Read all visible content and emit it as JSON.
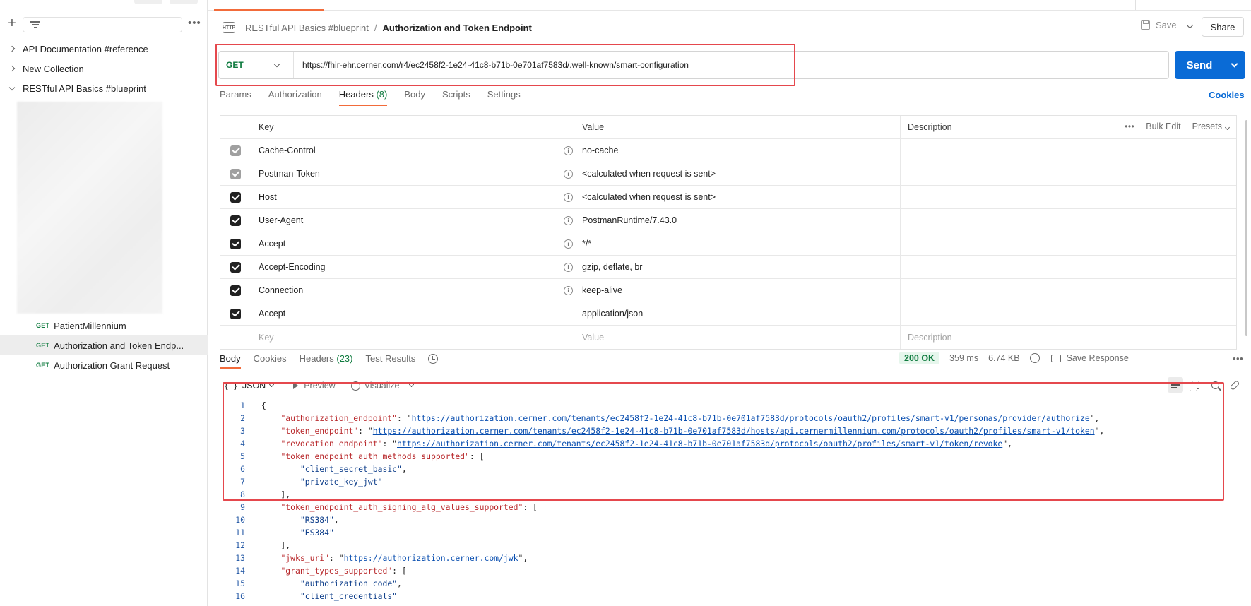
{
  "sidebar": {
    "collections": [
      {
        "label": "API Documentation #reference",
        "expanded": false
      },
      {
        "label": "New Collection",
        "expanded": false
      },
      {
        "label": "RESTful API Basics #blueprint",
        "expanded": true
      }
    ],
    "requests": [
      {
        "method": "GET",
        "label": "PatientMillennium",
        "active": false
      },
      {
        "method": "GET",
        "label": "Authorization and Token Endp...",
        "active": true
      },
      {
        "method": "GET",
        "label": "Authorization Grant Request",
        "active": false
      }
    ]
  },
  "breadcrumb": {
    "icon": "HTTP",
    "parent": "RESTful API Basics #blueprint",
    "separator": "/",
    "current": "Authorization and Token Endpoint"
  },
  "toolbar": {
    "save_label": "Save",
    "share_label": "Share"
  },
  "request": {
    "method": "GET",
    "url": "https://fhir-ehr.cerner.com/r4/ec2458f2-1e24-41c8-b71b-0e701af7583d/.well-known/smart-configuration",
    "send_label": "Send"
  },
  "request_tabs": [
    {
      "label": "Params",
      "count": ""
    },
    {
      "label": "Authorization",
      "count": ""
    },
    {
      "label": "Headers",
      "count": "(8)"
    },
    {
      "label": "Body",
      "count": ""
    },
    {
      "label": "Scripts",
      "count": ""
    },
    {
      "label": "Settings",
      "count": ""
    }
  ],
  "cookies_label": "Cookies",
  "headers_table": {
    "columns": {
      "key": "Key",
      "value": "Value",
      "description": "Description"
    },
    "tools": {
      "bulk_edit": "Bulk Edit",
      "presets": "Presets"
    },
    "rows": [
      {
        "key": "Cache-Control",
        "value": "no-cache",
        "checked": true,
        "auto": true,
        "info": true
      },
      {
        "key": "Postman-Token",
        "value": "<calculated when request is sent>",
        "checked": true,
        "auto": true,
        "info": true
      },
      {
        "key": "Host",
        "value": "<calculated when request is sent>",
        "checked": true,
        "auto": false,
        "info": true
      },
      {
        "key": "User-Agent",
        "value": "PostmanRuntime/7.43.0",
        "checked": true,
        "auto": false,
        "info": true
      },
      {
        "key": "Accept",
        "value": "*/*",
        "checked": true,
        "auto": false,
        "info": true
      },
      {
        "key": "Accept-Encoding",
        "value": "gzip, deflate, br",
        "checked": true,
        "auto": false,
        "info": true
      },
      {
        "key": "Connection",
        "value": "keep-alive",
        "checked": true,
        "auto": false,
        "info": true
      },
      {
        "key": "Accept",
        "value": "application/json",
        "checked": true,
        "auto": false,
        "info": false
      }
    ],
    "placeholders": {
      "key": "Key",
      "value": "Value",
      "description": "Description"
    }
  },
  "response_tabs": [
    {
      "label": "Body",
      "count": ""
    },
    {
      "label": "Cookies",
      "count": ""
    },
    {
      "label": "Headers",
      "count": "(23)"
    },
    {
      "label": "Test Results",
      "count": ""
    }
  ],
  "response_meta": {
    "status": "200 OK",
    "time": "359 ms",
    "size": "6.74 KB",
    "save_response": "Save Response"
  },
  "format_bar": {
    "format": "JSON",
    "preview": "Preview",
    "visualize": "Visualize"
  },
  "response_body": [
    {
      "n": "1",
      "parts": [
        {
          "t": "p",
          "v": "{"
        }
      ]
    },
    {
      "n": "2",
      "parts": [
        {
          "t": "p",
          "v": "    "
        },
        {
          "t": "k",
          "v": "\"authorization_endpoint\""
        },
        {
          "t": "p",
          "v": ": \""
        },
        {
          "t": "u",
          "v": "https://authorization.cerner.com/tenants/ec2458f2-1e24-41c8-b71b-0e701af7583d/protocols/oauth2/profiles/smart-v1/personas/provider/authorize"
        },
        {
          "t": "p",
          "v": "\","
        }
      ]
    },
    {
      "n": "3",
      "parts": [
        {
          "t": "p",
          "v": "    "
        },
        {
          "t": "k",
          "v": "\"token_endpoint\""
        },
        {
          "t": "p",
          "v": ": \""
        },
        {
          "t": "u",
          "v": "https://authorization.cerner.com/tenants/ec2458f2-1e24-41c8-b71b-0e701af7583d/hosts/api.cernermillennium.com/protocols/oauth2/profiles/smart-v1/token"
        },
        {
          "t": "p",
          "v": "\","
        }
      ]
    },
    {
      "n": "4",
      "parts": [
        {
          "t": "p",
          "v": "    "
        },
        {
          "t": "k",
          "v": "\"revocation_endpoint\""
        },
        {
          "t": "p",
          "v": ": \""
        },
        {
          "t": "u",
          "v": "https://authorization.cerner.com/tenants/ec2458f2-1e24-41c8-b71b-0e701af7583d/protocols/oauth2/profiles/smart-v1/token/revoke"
        },
        {
          "t": "p",
          "v": "\","
        }
      ]
    },
    {
      "n": "5",
      "parts": [
        {
          "t": "p",
          "v": "    "
        },
        {
          "t": "k",
          "v": "\"token_endpoint_auth_methods_supported\""
        },
        {
          "t": "p",
          "v": ": ["
        }
      ]
    },
    {
      "n": "6",
      "parts": [
        {
          "t": "p",
          "v": "        "
        },
        {
          "t": "s",
          "v": "\"client_secret_basic\""
        },
        {
          "t": "p",
          "v": ","
        }
      ]
    },
    {
      "n": "7",
      "parts": [
        {
          "t": "p",
          "v": "        "
        },
        {
          "t": "s",
          "v": "\"private_key_jwt\""
        }
      ]
    },
    {
      "n": "8",
      "parts": [
        {
          "t": "p",
          "v": "    ],"
        }
      ]
    },
    {
      "n": "9",
      "parts": [
        {
          "t": "p",
          "v": "    "
        },
        {
          "t": "k",
          "v": "\"token_endpoint_auth_signing_alg_values_supported\""
        },
        {
          "t": "p",
          "v": ": ["
        }
      ]
    },
    {
      "n": "10",
      "parts": [
        {
          "t": "p",
          "v": "        "
        },
        {
          "t": "s",
          "v": "\"RS384\""
        },
        {
          "t": "p",
          "v": ","
        }
      ]
    },
    {
      "n": "11",
      "parts": [
        {
          "t": "p",
          "v": "        "
        },
        {
          "t": "s",
          "v": "\"ES384\""
        }
      ]
    },
    {
      "n": "12",
      "parts": [
        {
          "t": "p",
          "v": "    ],"
        }
      ]
    },
    {
      "n": "13",
      "parts": [
        {
          "t": "p",
          "v": "    "
        },
        {
          "t": "k",
          "v": "\"jwks_uri\""
        },
        {
          "t": "p",
          "v": ": \""
        },
        {
          "t": "u",
          "v": "https://authorization.cerner.com/jwk"
        },
        {
          "t": "p",
          "v": "\","
        }
      ]
    },
    {
      "n": "14",
      "parts": [
        {
          "t": "p",
          "v": "    "
        },
        {
          "t": "k",
          "v": "\"grant_types_supported\""
        },
        {
          "t": "p",
          "v": ": ["
        }
      ]
    },
    {
      "n": "15",
      "parts": [
        {
          "t": "p",
          "v": "        "
        },
        {
          "t": "s",
          "v": "\"authorization_code\""
        },
        {
          "t": "p",
          "v": ","
        }
      ]
    },
    {
      "n": "16",
      "parts": [
        {
          "t": "p",
          "v": "        "
        },
        {
          "t": "s",
          "v": "\"client_credentials\""
        }
      ]
    }
  ],
  "colors": {
    "accent_orange": "#f26b3a",
    "send_blue": "#0a6bd6",
    "get_green": "#0f7b3f",
    "highlight_red": "#e5484d"
  }
}
